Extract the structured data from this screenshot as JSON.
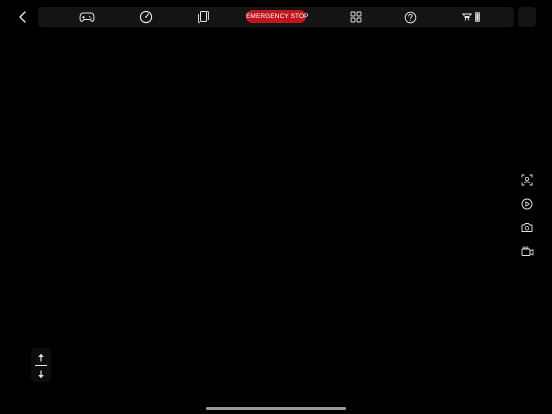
{
  "top_bar": {
    "back_icon": "chevron-left-icon",
    "tools": [
      {
        "icon": "gamepad-icon"
      },
      {
        "icon": "speedometer-icon"
      },
      {
        "icon": "phone-rotate-icon"
      },
      {
        "icon": "grid-icon"
      },
      {
        "icon": "help-circle-icon"
      },
      {
        "icon": "drone-battery-icon"
      }
    ],
    "emergency_stop_label": "EMERGENCY STOP"
  },
  "right_tools": [
    {
      "icon": "face-detect-icon"
    },
    {
      "icon": "play-circle-icon"
    },
    {
      "icon": "camera-icon"
    },
    {
      "icon": "video-camera-icon"
    }
  ],
  "altitude_control": {
    "up_icon": "arrow-up-icon",
    "down_icon": "arrow-down-icon"
  },
  "colors": {
    "background": "#000000",
    "toolbar_bg": "#141414",
    "emergency_stop": "#c0171e",
    "icon": "#e6e6e6"
  }
}
